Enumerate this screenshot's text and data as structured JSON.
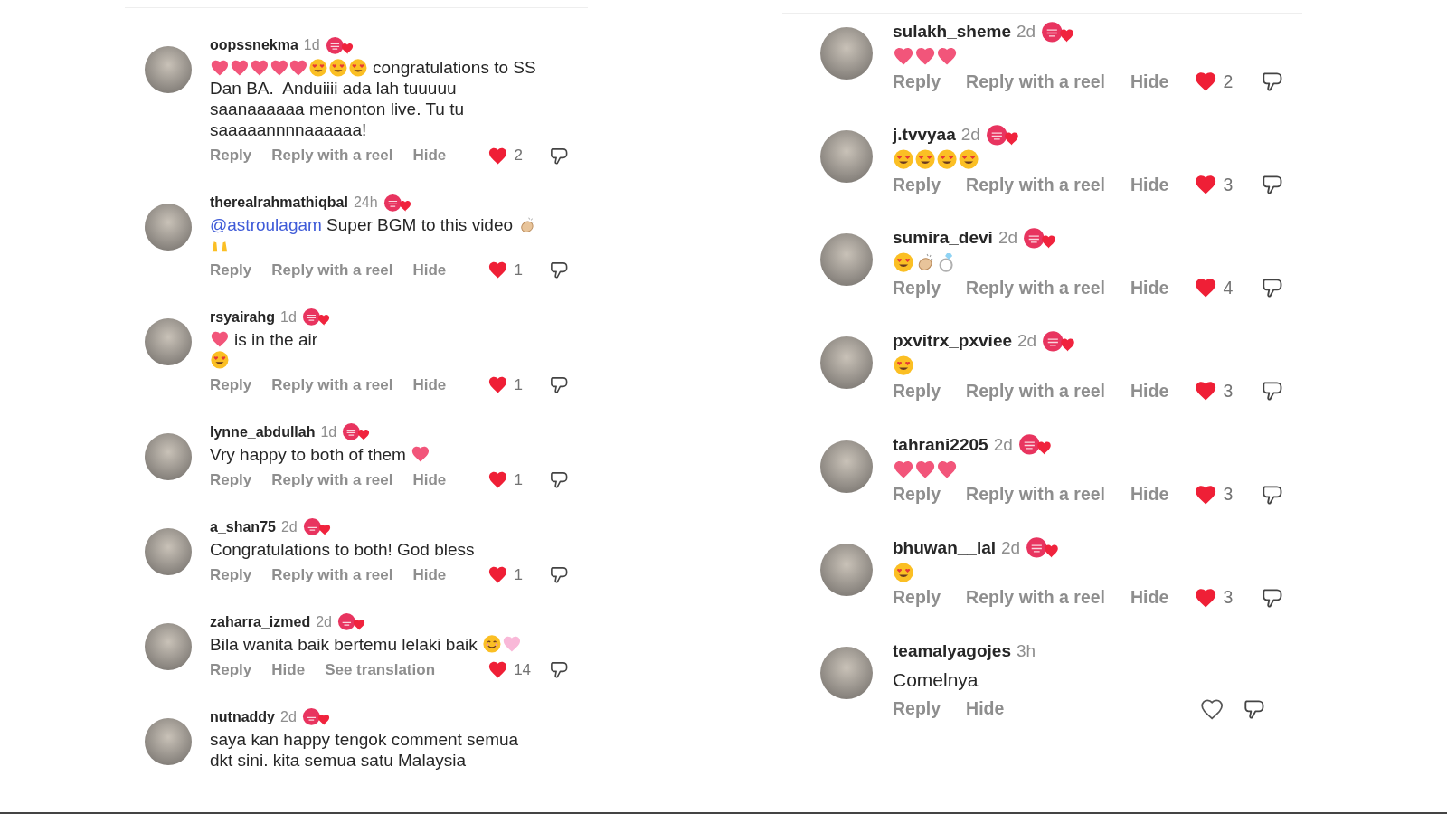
{
  "columns": [
    {
      "comments": [
        {
          "username": "oopssnekma",
          "time": "1d",
          "badge": true,
          "lines": [
            [
              {
                "kind": "heart"
              },
              {
                "kind": "heart"
              },
              {
                "kind": "heart"
              },
              {
                "kind": "heart"
              },
              {
                "kind": "heart"
              },
              {
                "kind": "hearteyes"
              },
              {
                "kind": "hearteyes"
              },
              {
                "kind": "hearteyes"
              },
              {
                "kind": "text",
                "text": " congratulations to SS"
              }
            ],
            [
              {
                "kind": "text",
                "text": "Dan BA.  Anduiiii ada lah tuuuuu"
              }
            ],
            [
              {
                "kind": "text",
                "text": "saanaaaaaa menonton live. Tu tu"
              }
            ],
            [
              {
                "kind": "text",
                "text": "saaaaannnnaaaaaa!"
              }
            ]
          ],
          "actions": [
            "Reply",
            "Reply with a reel",
            "Hide"
          ],
          "liked": true,
          "likes": "2"
        },
        {
          "username": "therealrahmathiqbal",
          "time": "24h",
          "badge": true,
          "lines": [
            [
              {
                "kind": "mention",
                "text": "@astroulagam"
              },
              {
                "kind": "text",
                "text": " Super BGM to this video "
              },
              {
                "kind": "clap"
              }
            ],
            [
              {
                "kind": "raisedhands"
              }
            ]
          ],
          "actions": [
            "Reply",
            "Reply with a reel",
            "Hide"
          ],
          "liked": true,
          "likes": "1"
        },
        {
          "username": "rsyairahg",
          "time": "1d",
          "badge": true,
          "lines": [
            [
              {
                "kind": "heart"
              },
              {
                "kind": "text",
                "text": " is in the air"
              }
            ],
            [
              {
                "kind": "hearteyes"
              }
            ]
          ],
          "actions": [
            "Reply",
            "Reply with a reel",
            "Hide"
          ],
          "liked": true,
          "likes": "1"
        },
        {
          "username": "lynne_abdullah",
          "time": "1d",
          "badge": true,
          "lines": [
            [
              {
                "kind": "text",
                "text": "Vry happy to both of them "
              },
              {
                "kind": "heart"
              }
            ]
          ],
          "actions": [
            "Reply",
            "Reply with a reel",
            "Hide"
          ],
          "liked": true,
          "likes": "1"
        },
        {
          "username": "a_shan75",
          "time": "2d",
          "badge": true,
          "lines": [
            [
              {
                "kind": "text",
                "text": "Congratulations to both! God bless"
              }
            ]
          ],
          "actions": [
            "Reply",
            "Reply with a reel",
            "Hide"
          ],
          "liked": true,
          "likes": "1"
        },
        {
          "username": "zaharra_izmed",
          "time": "2d",
          "badge": true,
          "lines": [
            [
              {
                "kind": "text",
                "text": "Bila wanita baik bertemu lelaki baik "
              },
              {
                "kind": "blush"
              },
              {
                "kind": "pinkheart"
              }
            ]
          ],
          "actions": [
            "Reply",
            "Hide",
            "See translation"
          ],
          "liked": true,
          "likes": "14"
        },
        {
          "username": "nutnaddy",
          "time": "2d",
          "badge": true,
          "lines": [
            [
              {
                "kind": "text",
                "text": "saya kan happy tengok comment semua"
              }
            ],
            [
              {
                "kind": "text",
                "text": "dkt sini. kita semua satu Malaysia"
              }
            ]
          ]
        }
      ]
    },
    {
      "comments": [
        {
          "username": "sulakh_sheme",
          "time": "2d",
          "badge": true,
          "lines": [
            [
              {
                "kind": "heart"
              },
              {
                "kind": "heart"
              },
              {
                "kind": "heart"
              }
            ]
          ],
          "actions": [
            "Reply",
            "Reply with a reel",
            "Hide"
          ],
          "liked": true,
          "likes": "2"
        },
        {
          "username": "j.tvvyaa",
          "time": "2d",
          "badge": true,
          "lines": [
            [
              {
                "kind": "hearteyes"
              },
              {
                "kind": "hearteyes"
              },
              {
                "kind": "hearteyes"
              },
              {
                "kind": "hearteyes"
              }
            ]
          ],
          "actions": [
            "Reply",
            "Reply with a reel",
            "Hide"
          ],
          "liked": true,
          "likes": "3"
        },
        {
          "username": "sumira_devi",
          "time": "2d",
          "badge": true,
          "lines": [
            [
              {
                "kind": "hearteyes"
              },
              {
                "kind": "clap"
              },
              {
                "kind": "ring"
              }
            ]
          ],
          "actions": [
            "Reply",
            "Reply with a reel",
            "Hide"
          ],
          "liked": true,
          "likes": "4"
        },
        {
          "username": "pxvitrx_pxviee",
          "time": "2d",
          "badge": true,
          "lines": [
            [
              {
                "kind": "hearteyes"
              }
            ]
          ],
          "actions": [
            "Reply",
            "Reply with a reel",
            "Hide"
          ],
          "liked": true,
          "likes": "3"
        },
        {
          "username": "tahrani2205",
          "time": "2d",
          "badge": true,
          "lines": [
            [
              {
                "kind": "heart"
              },
              {
                "kind": "heart"
              },
              {
                "kind": "heart"
              }
            ]
          ],
          "actions": [
            "Reply",
            "Reply with a reel",
            "Hide"
          ],
          "liked": true,
          "likes": "3"
        },
        {
          "username": "bhuwan__lal",
          "time": "2d",
          "badge": true,
          "lines": [
            [
              {
                "kind": "hearteyes"
              }
            ]
          ],
          "actions": [
            "Reply",
            "Reply with a reel",
            "Hide"
          ],
          "liked": true,
          "likes": "3"
        },
        {
          "username": "teamalyagojes",
          "time": "3h",
          "badge": false,
          "lines": [
            [
              {
                "kind": "text",
                "text": "Comelnya"
              }
            ]
          ],
          "actions": [
            "Reply",
            "Hide"
          ],
          "liked": false
        }
      ]
    }
  ]
}
